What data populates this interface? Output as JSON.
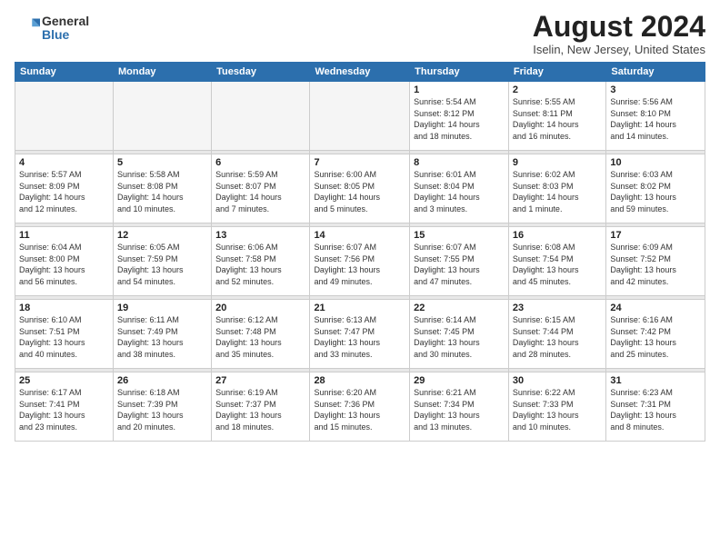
{
  "logo": {
    "general": "General",
    "blue": "Blue"
  },
  "header": {
    "title": "August 2024",
    "subtitle": "Iselin, New Jersey, United States"
  },
  "weekdays": [
    "Sunday",
    "Monday",
    "Tuesday",
    "Wednesday",
    "Thursday",
    "Friday",
    "Saturday"
  ],
  "weeks": [
    [
      {
        "day": "",
        "info": ""
      },
      {
        "day": "",
        "info": ""
      },
      {
        "day": "",
        "info": ""
      },
      {
        "day": "",
        "info": ""
      },
      {
        "day": "1",
        "info": "Sunrise: 5:54 AM\nSunset: 8:12 PM\nDaylight: 14 hours\nand 18 minutes."
      },
      {
        "day": "2",
        "info": "Sunrise: 5:55 AM\nSunset: 8:11 PM\nDaylight: 14 hours\nand 16 minutes."
      },
      {
        "day": "3",
        "info": "Sunrise: 5:56 AM\nSunset: 8:10 PM\nDaylight: 14 hours\nand 14 minutes."
      }
    ],
    [
      {
        "day": "4",
        "info": "Sunrise: 5:57 AM\nSunset: 8:09 PM\nDaylight: 14 hours\nand 12 minutes."
      },
      {
        "day": "5",
        "info": "Sunrise: 5:58 AM\nSunset: 8:08 PM\nDaylight: 14 hours\nand 10 minutes."
      },
      {
        "day": "6",
        "info": "Sunrise: 5:59 AM\nSunset: 8:07 PM\nDaylight: 14 hours\nand 7 minutes."
      },
      {
        "day": "7",
        "info": "Sunrise: 6:00 AM\nSunset: 8:05 PM\nDaylight: 14 hours\nand 5 minutes."
      },
      {
        "day": "8",
        "info": "Sunrise: 6:01 AM\nSunset: 8:04 PM\nDaylight: 14 hours\nand 3 minutes."
      },
      {
        "day": "9",
        "info": "Sunrise: 6:02 AM\nSunset: 8:03 PM\nDaylight: 14 hours\nand 1 minute."
      },
      {
        "day": "10",
        "info": "Sunrise: 6:03 AM\nSunset: 8:02 PM\nDaylight: 13 hours\nand 59 minutes."
      }
    ],
    [
      {
        "day": "11",
        "info": "Sunrise: 6:04 AM\nSunset: 8:00 PM\nDaylight: 13 hours\nand 56 minutes."
      },
      {
        "day": "12",
        "info": "Sunrise: 6:05 AM\nSunset: 7:59 PM\nDaylight: 13 hours\nand 54 minutes."
      },
      {
        "day": "13",
        "info": "Sunrise: 6:06 AM\nSunset: 7:58 PM\nDaylight: 13 hours\nand 52 minutes."
      },
      {
        "day": "14",
        "info": "Sunrise: 6:07 AM\nSunset: 7:56 PM\nDaylight: 13 hours\nand 49 minutes."
      },
      {
        "day": "15",
        "info": "Sunrise: 6:07 AM\nSunset: 7:55 PM\nDaylight: 13 hours\nand 47 minutes."
      },
      {
        "day": "16",
        "info": "Sunrise: 6:08 AM\nSunset: 7:54 PM\nDaylight: 13 hours\nand 45 minutes."
      },
      {
        "day": "17",
        "info": "Sunrise: 6:09 AM\nSunset: 7:52 PM\nDaylight: 13 hours\nand 42 minutes."
      }
    ],
    [
      {
        "day": "18",
        "info": "Sunrise: 6:10 AM\nSunset: 7:51 PM\nDaylight: 13 hours\nand 40 minutes."
      },
      {
        "day": "19",
        "info": "Sunrise: 6:11 AM\nSunset: 7:49 PM\nDaylight: 13 hours\nand 38 minutes."
      },
      {
        "day": "20",
        "info": "Sunrise: 6:12 AM\nSunset: 7:48 PM\nDaylight: 13 hours\nand 35 minutes."
      },
      {
        "day": "21",
        "info": "Sunrise: 6:13 AM\nSunset: 7:47 PM\nDaylight: 13 hours\nand 33 minutes."
      },
      {
        "day": "22",
        "info": "Sunrise: 6:14 AM\nSunset: 7:45 PM\nDaylight: 13 hours\nand 30 minutes."
      },
      {
        "day": "23",
        "info": "Sunrise: 6:15 AM\nSunset: 7:44 PM\nDaylight: 13 hours\nand 28 minutes."
      },
      {
        "day": "24",
        "info": "Sunrise: 6:16 AM\nSunset: 7:42 PM\nDaylight: 13 hours\nand 25 minutes."
      }
    ],
    [
      {
        "day": "25",
        "info": "Sunrise: 6:17 AM\nSunset: 7:41 PM\nDaylight: 13 hours\nand 23 minutes."
      },
      {
        "day": "26",
        "info": "Sunrise: 6:18 AM\nSunset: 7:39 PM\nDaylight: 13 hours\nand 20 minutes."
      },
      {
        "day": "27",
        "info": "Sunrise: 6:19 AM\nSunset: 7:37 PM\nDaylight: 13 hours\nand 18 minutes."
      },
      {
        "day": "28",
        "info": "Sunrise: 6:20 AM\nSunset: 7:36 PM\nDaylight: 13 hours\nand 15 minutes."
      },
      {
        "day": "29",
        "info": "Sunrise: 6:21 AM\nSunset: 7:34 PM\nDaylight: 13 hours\nand 13 minutes."
      },
      {
        "day": "30",
        "info": "Sunrise: 6:22 AM\nSunset: 7:33 PM\nDaylight: 13 hours\nand 10 minutes."
      },
      {
        "day": "31",
        "info": "Sunrise: 6:23 AM\nSunset: 7:31 PM\nDaylight: 13 hours\nand 8 minutes."
      }
    ]
  ]
}
